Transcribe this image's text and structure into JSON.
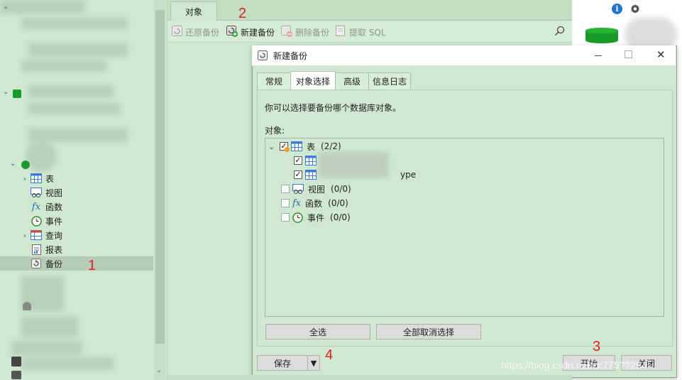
{
  "sidebar": {
    "items": [
      {
        "label": "表",
        "icon": "table-icon",
        "chev": "›"
      },
      {
        "label": "视图",
        "icon": "view-icon",
        "chev": ""
      },
      {
        "label": "函数",
        "icon": "function-icon",
        "chev": ""
      },
      {
        "label": "事件",
        "icon": "event-icon",
        "chev": ""
      },
      {
        "label": "查询",
        "icon": "query-icon",
        "chev": "›"
      },
      {
        "label": "报表",
        "icon": "report-icon",
        "chev": ""
      },
      {
        "label": "备份",
        "icon": "backup-icon",
        "chev": "",
        "selected": true
      }
    ]
  },
  "tabs": {
    "objects_label": "对象"
  },
  "toolbar": {
    "restore_label": "还原备份",
    "new_label": "新建备份",
    "delete_label": "删除备份",
    "extract_label": "提取 SQL"
  },
  "annotations": [
    "1",
    "2",
    "3",
    "4"
  ],
  "dialog": {
    "title": "新建备份",
    "tabs": [
      "常规",
      "对象选择",
      "高级",
      "信息日志"
    ],
    "active_tab": "对象选择",
    "hint": "你可以选择要备份哪个数据库对象。",
    "objects_label": "对象:",
    "tree": {
      "table_node": {
        "label": "表",
        "count": "(2/2)"
      },
      "table_children": [
        {
          "label": ""
        },
        {
          "label": "ype"
        }
      ],
      "view_node": {
        "label": "视图",
        "count": "(0/0)"
      },
      "function_node": {
        "label": "函数",
        "count": "(0/0)"
      },
      "event_node": {
        "label": "事件",
        "count": "(0/0)"
      }
    },
    "select_all_label": "全选",
    "deselect_all_label": "全部取消选择",
    "save_label": "保存",
    "start_label": "开始",
    "close_label": "关闭"
  },
  "watermark": "https://blog.csdn.net/cc775??294",
  "colors": {
    "background": "#cfe8cf",
    "annotation": "#e02020",
    "table_icon": "#3a7bd5",
    "db_green": "#1a9a2a"
  }
}
